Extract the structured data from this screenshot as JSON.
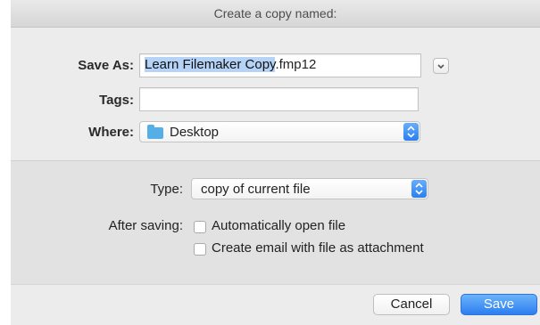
{
  "dialog": {
    "title": "Create a copy named:"
  },
  "save_as": {
    "label": "Save As:",
    "filename_selected": "Learn Filemaker Copy",
    "filename_extension": ".fmp12"
  },
  "tags": {
    "label": "Tags:",
    "value": ""
  },
  "where": {
    "label": "Where:",
    "selected": "Desktop"
  },
  "type": {
    "label": "Type:",
    "selected": "copy of current file"
  },
  "after_saving": {
    "label": "After saving:",
    "options": [
      {
        "label": "Automatically open file",
        "checked": false
      },
      {
        "label": "Create email with file as attachment",
        "checked": false
      }
    ]
  },
  "buttons": {
    "cancel": "Cancel",
    "save": "Save"
  },
  "colors": {
    "accent": "#2c7ef0",
    "selection": "#b4d3f7",
    "folder": "#55aee6"
  }
}
